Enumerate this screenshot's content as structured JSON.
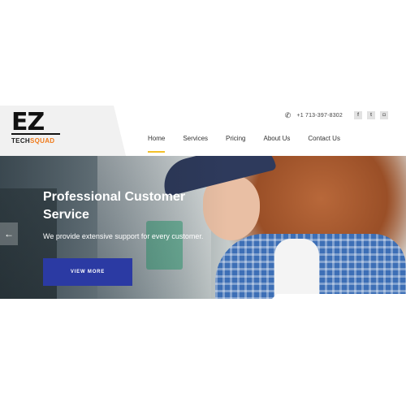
{
  "brand": {
    "logo_main": "EZ",
    "logo_tech": "TECH",
    "logo_squad": "SQUAD",
    "accent_orange": "#f07a1a"
  },
  "topbar": {
    "phone_icon": "phone-icon",
    "phone": "+1 713-397-8302",
    "social": [
      {
        "name": "facebook-icon",
        "glyph": "f"
      },
      {
        "name": "twitter-icon",
        "glyph": "t"
      },
      {
        "name": "instagram-icon",
        "glyph": "◘"
      }
    ]
  },
  "nav": {
    "items": [
      {
        "label": "Home",
        "active": true
      },
      {
        "label": "Services",
        "active": false
      },
      {
        "label": "Pricing",
        "active": false
      },
      {
        "label": "About Us",
        "active": false
      },
      {
        "label": "Contact Us",
        "active": false
      }
    ],
    "active_color": "#f3c12a"
  },
  "hero": {
    "title": "Professional Customer Service",
    "subtitle": "We provide extensive support for every customer.",
    "cta_label": "VIEW MORE",
    "cta_color": "#2b3aa3",
    "prev_arrow": "←"
  }
}
